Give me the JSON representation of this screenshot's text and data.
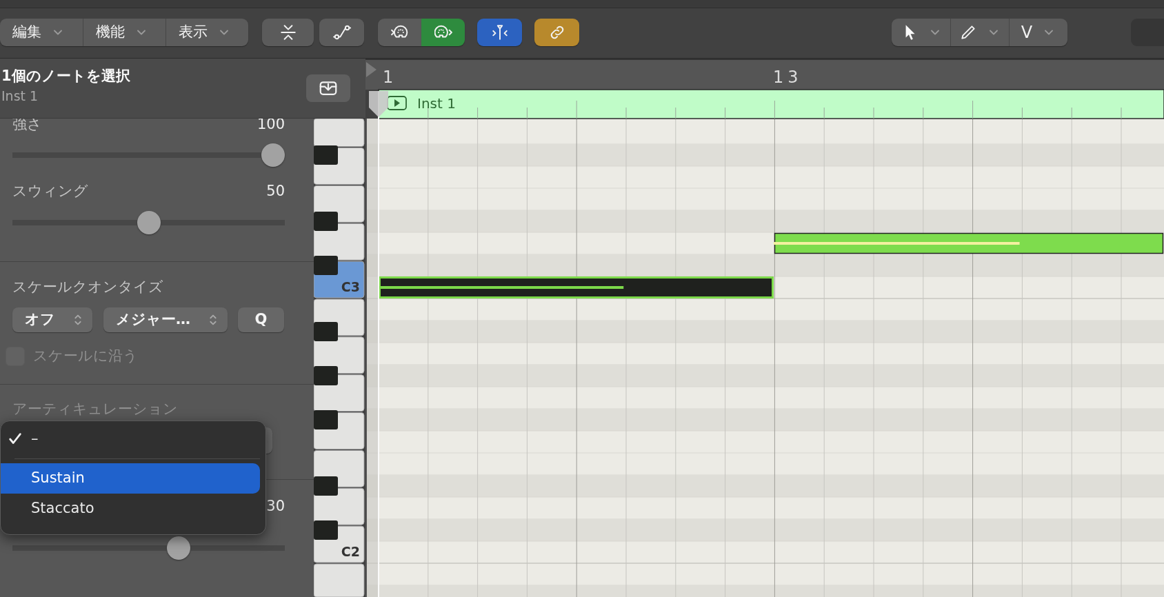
{
  "toolbar": {
    "menus": [
      {
        "label": "編集"
      },
      {
        "label": "機能"
      },
      {
        "label": "表示"
      }
    ],
    "buttons": [
      {
        "kind": "collapse",
        "on": false
      },
      {
        "kind": "automation",
        "on": false
      },
      {
        "kind": "midi-in",
        "on": false
      },
      {
        "kind": "midi-out",
        "on": true,
        "color": "#2e8b3e"
      },
      {
        "kind": "catch",
        "on": true,
        "color": "#2c62c0"
      },
      {
        "kind": "link",
        "on": true,
        "color": "#b8892c"
      }
    ],
    "tools": [
      {
        "kind": "pointer"
      },
      {
        "kind": "pencil"
      },
      {
        "kind": "text",
        "label": "V"
      }
    ]
  },
  "header": {
    "title": "1個のノートを選択",
    "subtitle": "Inst 1"
  },
  "inspector": {
    "sliders": [
      {
        "label": "強さ",
        "value": "100",
        "level": 1.0
      },
      {
        "label": "スウィング",
        "value": "50",
        "level": 0.5
      }
    ],
    "scale_quantize": {
      "label": "スケールクオンタイズ",
      "popups": [
        {
          "value": "オフ"
        },
        {
          "value": "メジャー…"
        }
      ],
      "button": "Q",
      "checkbox": {
        "label": "スケールに沿う",
        "checked": false,
        "disabled": true
      }
    },
    "articulation": {
      "label": "アーティキュレーション"
    },
    "hidden_slider": {
      "value": "30",
      "level": 0.62
    }
  },
  "articulation_menu": [
    {
      "kind": "item",
      "label": "–",
      "checked": true,
      "selected": false
    },
    {
      "kind": "separator"
    },
    {
      "kind": "item",
      "label": "Sustain",
      "checked": false,
      "selected": true
    },
    {
      "kind": "item",
      "label": "Staccato",
      "checked": false,
      "selected": false
    }
  ],
  "ruler": [
    "1",
    "13"
  ],
  "region": {
    "name": "Inst 1"
  },
  "piano": {
    "keys": [
      {
        "label": "C3",
        "selected": true
      },
      {
        "label": "C2",
        "selected": false
      }
    ]
  },
  "notes": [
    {
      "selected": true,
      "level": 0.62
    },
    {
      "selected": false,
      "level": 0.63
    }
  ]
}
